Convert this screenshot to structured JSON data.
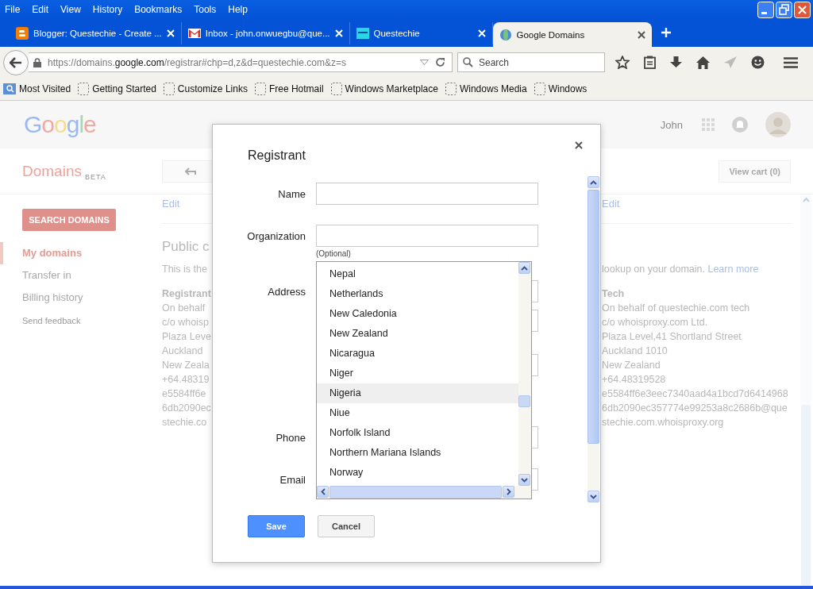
{
  "menu": [
    "File",
    "Edit",
    "View",
    "History",
    "Bookmarks",
    "Tools",
    "Help"
  ],
  "tabs": [
    {
      "title": "Blogger: Questechie - Create ...",
      "selected": false
    },
    {
      "title": "Inbox - john.onwuegbu@que...",
      "selected": false
    },
    {
      "title": "Questechie",
      "selected": false
    },
    {
      "title": "Google Domains",
      "selected": true
    }
  ],
  "address_bar": {
    "scheme": "https://domains.",
    "host": "google.com",
    "path": "/registrar#chp=d,z&d=questechie.com&z=s"
  },
  "search": {
    "placeholder": "Search"
  },
  "bookmarks": [
    "Most Visited",
    "Getting Started",
    "Customize Links",
    "Free Hotmail",
    "Windows Marketplace",
    "Windows Media",
    "Windows"
  ],
  "header": {
    "logo": "Google",
    "user": "John"
  },
  "product": {
    "name": "Domains",
    "badge": "BETA"
  },
  "view_cart": "View cart (0)",
  "sidebar": {
    "button": "SEARCH DOMAINS",
    "items": [
      {
        "label": "My domains",
        "selected": true
      },
      {
        "label": "Transfer in",
        "selected": false
      },
      {
        "label": "Billing history",
        "selected": false
      }
    ],
    "feedback": "Send feedback"
  },
  "content": {
    "left": {
      "edit": "Edit",
      "heading": "Public c",
      "intro": "This is the",
      "contact_title": "Registrant",
      "lines": [
        "On behalf",
        "c/o whoisp",
        "Plaza Leve",
        "Auckland",
        "New Zeala",
        "+64.48319",
        "e5584ff6e",
        "6db2090ec",
        "stechie.co"
      ]
    },
    "right": {
      "edit": "Edit",
      "intro": "lookup on your domain.",
      "link": "Learn more",
      "contact_title": "Tech",
      "lines": [
        "On behalf of questechie.com tech",
        "c/o whoisproxy.com Ltd.",
        "Plaza Level,41 Shortland Street",
        "Auckland 1010",
        "New Zealand",
        "+64.48319528",
        "e5584ff6e3eec7340aad4a1bcd7d6414968",
        "6db2090ec357774e99253a8c2686b@que",
        "stechie.com.whoisproxy.org"
      ]
    }
  },
  "dialog": {
    "title": "Registrant",
    "fields": [
      {
        "label": "Name",
        "kind": "text"
      },
      {
        "label": "Organization",
        "kind": "text",
        "hint": "(Optional)"
      },
      {
        "label": "Address",
        "kind": "address"
      },
      {
        "label": "Phone",
        "kind": "text"
      },
      {
        "label": "Email",
        "kind": "text"
      }
    ],
    "country_options": [
      {
        "label": "Nepal",
        "selected": false
      },
      {
        "label": "Netherlands",
        "selected": false
      },
      {
        "label": "New Caledonia",
        "selected": false
      },
      {
        "label": "New Zealand",
        "selected": false
      },
      {
        "label": "Nicaragua",
        "selected": false
      },
      {
        "label": "Niger",
        "selected": false
      },
      {
        "label": "Nigeria",
        "selected": true
      },
      {
        "label": "Niue",
        "selected": false
      },
      {
        "label": "Norfolk Island",
        "selected": false
      },
      {
        "label": "Northern Mariana Islands",
        "selected": false
      },
      {
        "label": "Norway",
        "selected": false
      }
    ],
    "buttons": [
      {
        "label": "Save",
        "kind": "primary"
      },
      {
        "label": "Cancel",
        "kind": "secondary"
      }
    ]
  }
}
